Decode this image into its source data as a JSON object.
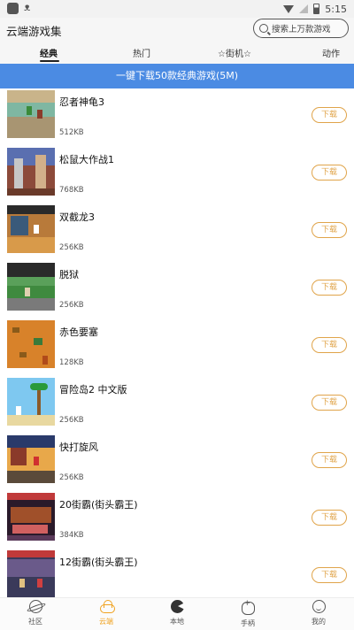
{
  "status_bar": {
    "time": "5:15",
    "app_icon": "bug-icon"
  },
  "header": {
    "title": "云端游戏集",
    "search_placeholder": "搜索上万款游戏"
  },
  "tabs": [
    {
      "label": "经典",
      "active": true
    },
    {
      "label": "热门",
      "active": false
    },
    {
      "label": "☆街机☆",
      "active": false
    },
    {
      "label": "动作",
      "active": false
    }
  ],
  "banner": {
    "text": "一键下载50款经典游戏(5M)"
  },
  "download_label": "下载",
  "games": [
    {
      "name": "忍者神龟3",
      "size": "512KB"
    },
    {
      "name": "松鼠大作战1",
      "size": "768KB"
    },
    {
      "name": "双截龙3",
      "size": "256KB"
    },
    {
      "name": "脱狱",
      "size": "256KB"
    },
    {
      "name": "赤色要塞",
      "size": "128KB"
    },
    {
      "name": "冒险岛2 中文版",
      "size": "256KB"
    },
    {
      "name": "快打旋风",
      "size": "256KB"
    },
    {
      "name": "20街霸(街头霸王)",
      "size": "384KB"
    },
    {
      "name": "12街霸(街头霸王)",
      "size": ""
    }
  ],
  "bottom_nav": [
    {
      "label": "社区",
      "icon": "planet-icon",
      "active": false
    },
    {
      "label": "云端",
      "icon": "cloud-icon",
      "active": true
    },
    {
      "label": "本地",
      "icon": "pacman-icon",
      "active": false
    },
    {
      "label": "手柄",
      "icon": "gamepad-icon",
      "active": false
    },
    {
      "label": "我的",
      "icon": "face-icon",
      "active": false
    }
  ],
  "colors": {
    "accent": "#f0a21f",
    "banner": "#4b8be3",
    "download_border": "#e0a44a"
  }
}
